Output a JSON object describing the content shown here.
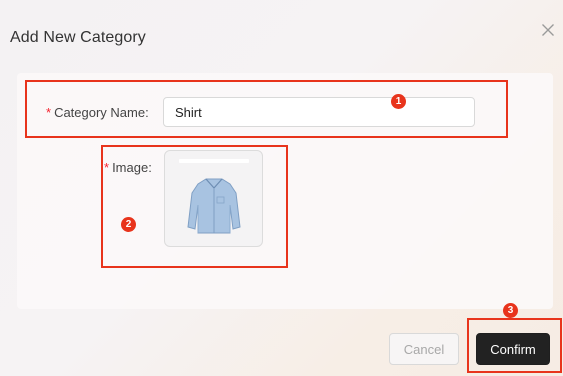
{
  "dialog": {
    "title": "Add New Category",
    "close_icon": "close-icon"
  },
  "form": {
    "category_name": {
      "required_mark": "*",
      "label": "Category Name:",
      "value": "Shirt"
    },
    "image": {
      "required_mark": "*",
      "label": "Image:",
      "preview_icon": "shirt-image"
    }
  },
  "footer": {
    "cancel_label": "Cancel",
    "confirm_label": "Confirm"
  },
  "annotations": {
    "color": "#e8341c",
    "badges": [
      "1",
      "2",
      "3"
    ]
  },
  "colors": {
    "confirm_background": "#222222",
    "required_asterisk": "#f5222d"
  }
}
